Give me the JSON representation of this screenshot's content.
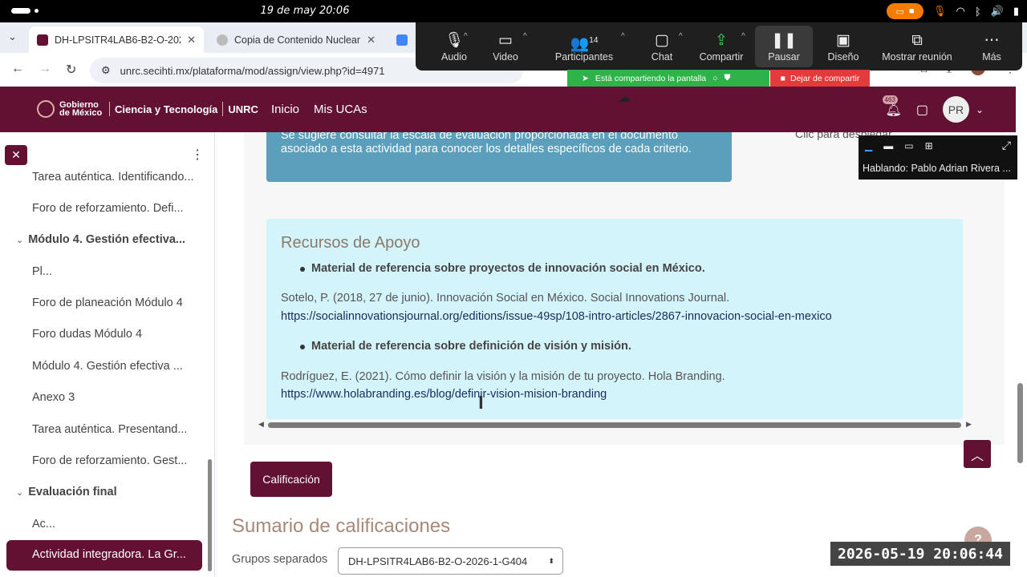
{
  "os": {
    "clock": "19 de may  20:06"
  },
  "browser": {
    "tabs": [
      {
        "title": "DH-LPSITR4LAB6-B2-O-202",
        "active": true
      },
      {
        "title": "Copia de Contenido Nuclear",
        "active": false
      },
      {
        "title": "C",
        "active": false
      }
    ],
    "url": "unrc.secihti.mx/plataforma/mod/assign/view.php?id=4971"
  },
  "zoom": {
    "buttons": [
      "Audio",
      "Video",
      "Participantes",
      "Chat",
      "Compartir",
      "Pausar",
      "Diseño",
      "Mostrar reunión",
      "Más"
    ],
    "participants_count": "14",
    "sharing_banner": "Está compartiendo la pantalla",
    "stop_sharing": "Dejar de compartir",
    "speaker": "Hablando: Pablo Adrian Rivera ..."
  },
  "header": {
    "logo_gob": "Gobierno de México",
    "logo_ct": "Ciencia y Tecnología",
    "logo_unrc": "UNRC",
    "nav": [
      "Inicio",
      "Mis UCAs"
    ],
    "notif_count": "463",
    "user_initials": "PR"
  },
  "sidebar": {
    "items": [
      "Tarea auténtica. Identificando...",
      "Foro de reforzamiento. Defi...",
      "Módulo 4. Gestión efectiva...",
      "Pl...",
      "Foro de planeación Módulo 4",
      "Foro dudas Módulo 4",
      "Módulo 4. Gestión efectiva ...",
      "Anexo 3",
      "Tarea auténtica. Presentand...",
      "Foro de reforzamiento. Gest...",
      "Evaluación final",
      "Ac..."
    ],
    "active_item": "Actividad integradora. La Gr..."
  },
  "main": {
    "info_text_1": "Se sugiere consultar la escala de evaluación proporcionada en el documento",
    "info_text_2": "asociado a esta actividad para conocer los detalles específicos de cada criterio.",
    "side_hint": "Clic para desplegar",
    "resources": {
      "title": "Recursos de Apoyo",
      "bullet_1": "Material de referencia sobre proyectos de innovación social en México.",
      "ref_1": "Sotelo, P. (2018, 27 de junio). Innovación Social en México. Social Innovations Journal.",
      "link_1": "https://socialinnovationsjournal.org/editions/issue-49sp/108-intro-articles/2867-innovacion-social-en-mexico",
      "bullet_2": "Material de referencia sobre definición de visión y misión.",
      "ref_2": "Rodríguez, E. (2021). Cómo definir la visión y la misión de tu proyecto. Hola Branding.",
      "link_2": "https://www.holabranding.es/blog/definir-vision-mision-branding"
    },
    "grade_button": "Calificación",
    "summary_title": "Sumario de calificaciones",
    "groups_label": "Grupos separados",
    "groups_value": "DH-LPSITR4LAB6-B2-O-2026-1-G404"
  },
  "timestamp": "2026-05-19 20:06:44",
  "colors": {
    "brand": "#621132",
    "info": "#5b9fbd",
    "resources_bg": "#d4f4fb"
  }
}
